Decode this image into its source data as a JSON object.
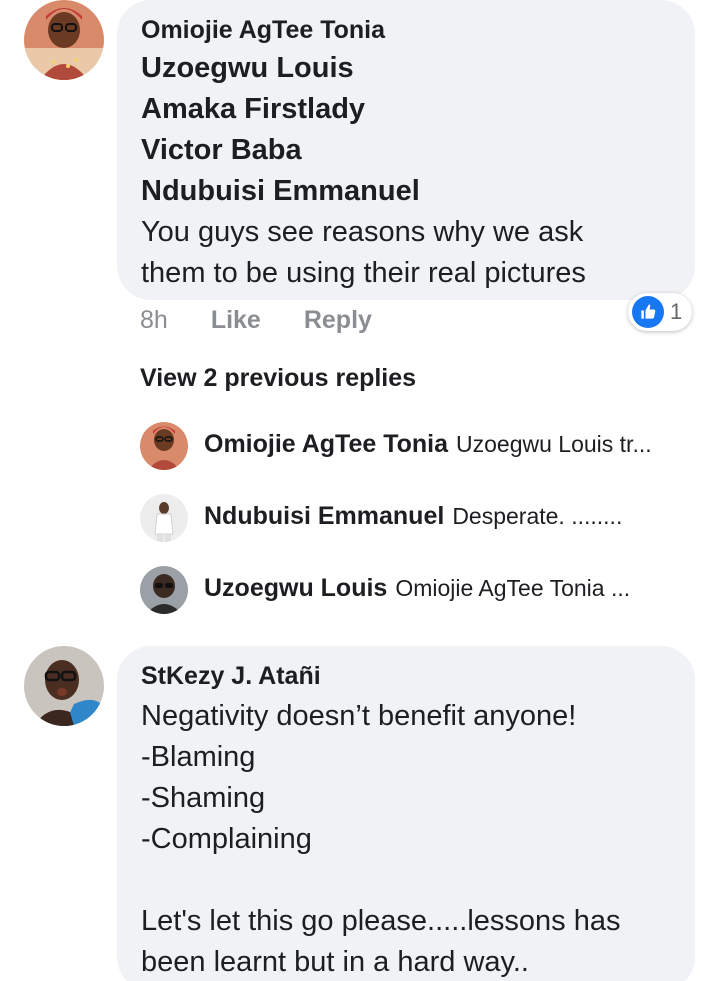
{
  "comment1": {
    "author": "Omiojie AgTee Tonia",
    "tags": [
      "Uzoegwu Louis",
      "Amaka Firstlady",
      "Victor Baba",
      "Ndubuisi Emmanuel"
    ],
    "text_line1": "You guys see reasons why we ask",
    "text_line2": "them to be using their real pictures",
    "time": "8h",
    "like_label": "Like",
    "reply_label": "Reply",
    "reaction_count": "1",
    "reaction_icon": "thumbs-up-icon",
    "reaction_color": "#1877f2"
  },
  "view_previous": "View 2 previous replies",
  "replies": [
    {
      "name": "Omiojie AgTee Tonia",
      "snippet": "Uzoegwu Louis tr..."
    },
    {
      "name": "Ndubuisi Emmanuel",
      "snippet": "Desperate. ........"
    },
    {
      "name": "Uzoegwu Louis",
      "snippet": "Omiojie AgTee Tonia ..."
    }
  ],
  "comment2": {
    "author": "StKezy J. Atañi",
    "lines": [
      "Negativity doesn’t benefit anyone!",
      "-Blaming",
      "-Shaming",
      "-Complaining",
      "",
      "Let's let this go please.....lessons has",
      "been learnt but in a hard way.."
    ]
  },
  "colors": {
    "bubble": "#f0f2f5",
    "meta_text": "#8a8d91",
    "primary_text": "#1c1e21"
  }
}
